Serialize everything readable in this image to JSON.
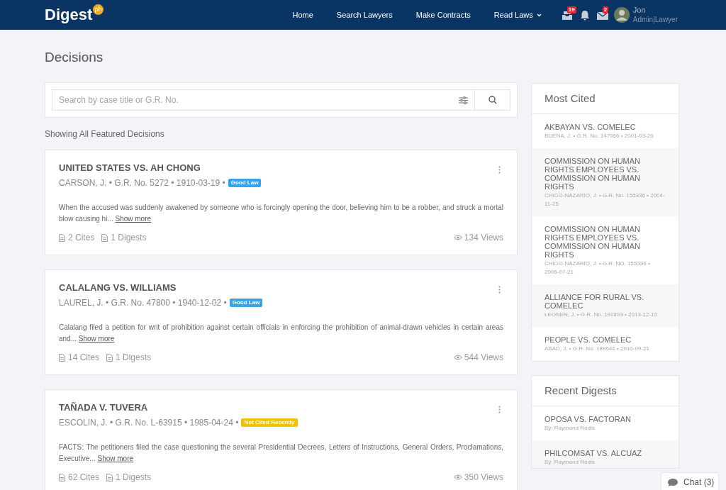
{
  "header": {
    "logo": "Digest",
    "logo_badge": "ph",
    "nav": [
      {
        "label": "Home",
        "dropdown": false
      },
      {
        "label": "Search Lawyers",
        "dropdown": false
      },
      {
        "label": "Make Contracts",
        "dropdown": false
      },
      {
        "label": "Read Laws",
        "dropdown": true
      }
    ],
    "notifications": [
      {
        "kind": "inbox",
        "count": "19"
      },
      {
        "kind": "bell"
      },
      {
        "kind": "mail",
        "count": "2"
      }
    ],
    "user": {
      "name": "Jon",
      "role": "Admin|Lawyer"
    }
  },
  "page_title": "Decisions",
  "search": {
    "placeholder": "Search by case title or G.R. No."
  },
  "showing": "Showing All Featured Decisions",
  "decisions": [
    {
      "title": "UNITED STATES VS. AH CHONG",
      "meta": "CARSON, J. • G.R. No. 5272 • 1910-03-19 •",
      "badge": {
        "text": "Good Law",
        "color": "#35a4ec"
      },
      "summary": "When the accused was suddenly awakened by someone who is forcingly opening the door, believing him to be a robber, and struck a mortal blow causing hi...",
      "more": "Show more",
      "cites": "2 Cites",
      "digests": "1 Digests",
      "views": "134 Views"
    },
    {
      "title": "CALALANG VS. WILLIAMS",
      "meta": "LAUREL, J. • G.R. No. 47800 • 1940-12-02 •",
      "badge": {
        "text": "Good Law",
        "color": "#35a4ec"
      },
      "summary": "Calalang filed a petition for writ of prohibition against certain officials in enforcing the prohibition of animal-drawn vehicles in certain areas and...",
      "more": "Show more",
      "cites": "14 Cites",
      "digests": "1 Digests",
      "views": "544 Views"
    },
    {
      "title": "TAÑADA V. TUVERA",
      "meta": "ESCOLIN, J. • G.R. No. L-63915 • 1985-04-24 •",
      "badge": {
        "text": "Not Cited Recently",
        "color": "#f2c200"
      },
      "summary": "FACTS: The petitioners filed the case questioning the several Presidential Decrees, Letters of Instructions, General Orders, Proclamations, Executive...",
      "more": "Show more",
      "cites": "62 Cites",
      "digests": "1 Digests",
      "views": "350 Views"
    }
  ],
  "most_cited": {
    "title": "Most Cited",
    "items": [
      {
        "title": "AKBAYAN VS. COMELEC",
        "meta": "BUENA, J. • G.R. No. 147066 • 2001-03-26"
      },
      {
        "title": "COMMISSION ON HUMAN RIGHTS EMPLOYEES VS. COMMISSION ON HUMAN RIGHTS",
        "meta": "CHICO-NAZARIO, J. • G.R. No. 155336 • 2004-11-25"
      },
      {
        "title": "COMMISSION ON HUMAN RIGHTS EMPLOYEES VS. COMMISSION ON HUMAN RIGHTS",
        "meta": "CHICO-NAZARIO, J. • G.R. NO. 155336 • 2006-07-21"
      },
      {
        "title": "ALLIANCE FOR RURAL VS. COMELEC",
        "meta": "LEONEN, J. • G.R. No. 192803 • 2013-12-10"
      },
      {
        "title": "PEOPLE VS. COMELEC",
        "meta": "ABAD, J. • G.R. No. 189546 • 2010-09-21"
      }
    ]
  },
  "recent_digests": {
    "title": "Recent Digests",
    "items": [
      {
        "title": "OPOSA VS. FACTORAN",
        "meta": "By: Raymond Rodis"
      },
      {
        "title": "PHILCOMSAT VS. ALCUAZ",
        "meta": "By: Raymond Rodis"
      }
    ]
  },
  "chat": {
    "label": "Chat (3)"
  }
}
